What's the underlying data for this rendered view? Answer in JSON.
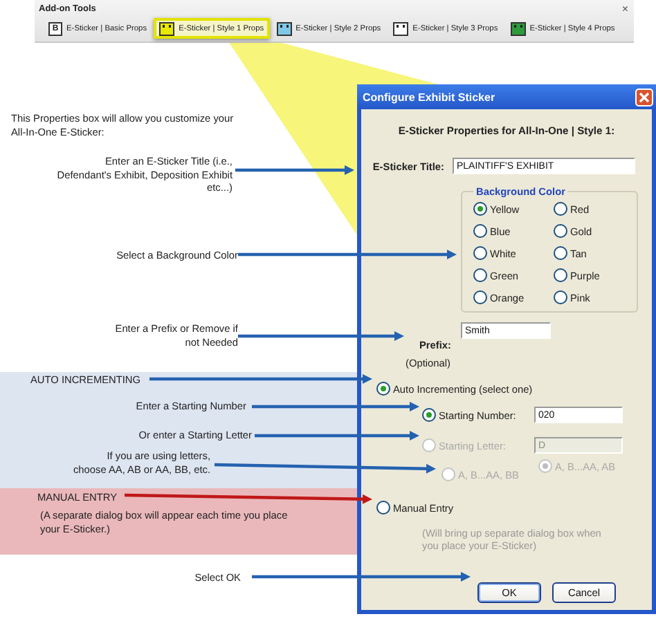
{
  "toolbar": {
    "title": "Add-on Tools",
    "close": "×",
    "buttons": [
      {
        "kind": "letter",
        "glyph": "B",
        "label": "E-Sticker | Basic Props",
        "selected": false
      },
      {
        "kind": "sticker",
        "color": "#e8e800",
        "label": "E-Sticker | Style 1 Props",
        "selected": true
      },
      {
        "kind": "sticker",
        "color": "#7fc8e8",
        "label": "E-Sticker | Style 2 Props",
        "selected": false
      },
      {
        "kind": "sticker",
        "color": "#ffffff",
        "label": "E-Sticker | Style 3 Props",
        "selected": false
      },
      {
        "kind": "sticker",
        "color": "#2e9a3c",
        "label": "E-Sticker | Style 4 Props",
        "selected": false
      }
    ]
  },
  "annotations": {
    "intro": "This Properties box will allow you customize your\nAll-In-One E-Sticker:",
    "title_hint": "Enter an E-Sticker Title (i.e.,\nDefendant's Exhibit, Deposition Exhibit\netc...)",
    "color_hint": "Select a Background Color",
    "prefix_hint": "Enter a Prefix or Remove if\nnot Needed",
    "auto_band": {
      "heading": "AUTO INCREMENTING",
      "notes": [
        "Enter a Starting Number",
        "Or enter a Starting Letter",
        "If you are using letters,\nchoose AA, AB or AA, BB, etc."
      ]
    },
    "manual_band": {
      "heading": "MANUAL ENTRY",
      "note": "(A separate dialog box will appear each time you place\nyour E-Sticker.)"
    },
    "ok_hint": "Select OK"
  },
  "dialog": {
    "title": "Configure Exhibit Sticker",
    "heading": "E-Sticker Properties for All-In-One | Style 1:",
    "title_field": {
      "label": "E-Sticker Title:",
      "value": "PLAINTIFF'S EXHIBIT"
    },
    "background_color": {
      "legend": "Background Color",
      "options": [
        {
          "label": "Yellow",
          "selected": true
        },
        {
          "label": "Red",
          "selected": false
        },
        {
          "label": "Blue",
          "selected": false
        },
        {
          "label": "Gold",
          "selected": false
        },
        {
          "label": "White",
          "selected": false
        },
        {
          "label": "Tan",
          "selected": false
        },
        {
          "label": "Green",
          "selected": false
        },
        {
          "label": "Purple",
          "selected": false
        },
        {
          "label": "Orange",
          "selected": false
        },
        {
          "label": "Pink",
          "selected": false
        }
      ]
    },
    "prefix": {
      "label": "Prefix:",
      "hint": "(Optional)",
      "value": "Smith"
    },
    "auto_incrementing": {
      "label": "Auto Incrementing (select one)",
      "selected": true
    },
    "starting_number": {
      "label": "Starting Number:",
      "selected": true,
      "value": "020",
      "disabled": false
    },
    "starting_letter": {
      "label": "Starting Letter:",
      "selected": false,
      "value": "D",
      "disabled": true
    },
    "letter_styles": [
      {
        "label": "A, B...AA, BB",
        "selected": false,
        "disabled": true
      },
      {
        "label": "A, B...AA, AB",
        "selected": true,
        "disabled": true
      }
    ],
    "manual_entry": {
      "label": "Manual Entry",
      "selected": false,
      "note": "(Will bring up separate dialog box when you place your E-Sticker)"
    },
    "buttons": [
      "OK",
      "Cancel"
    ]
  }
}
